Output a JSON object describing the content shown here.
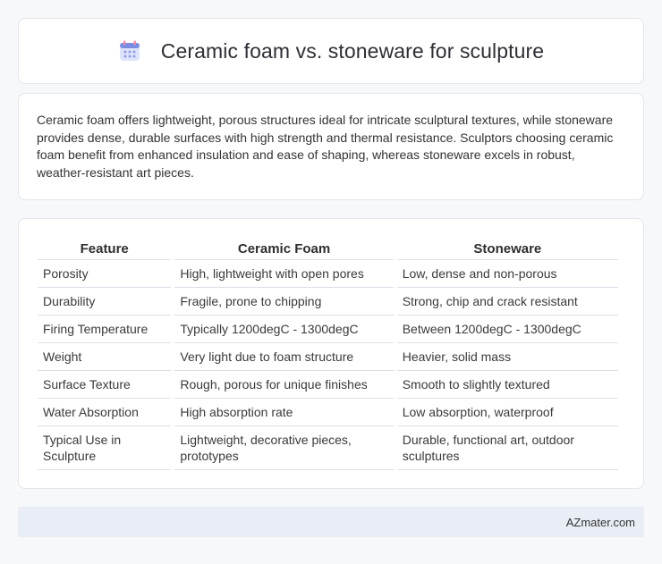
{
  "header": {
    "title": "Ceramic foam vs. stoneware for sculpture",
    "icon": "calendar-icon"
  },
  "intro": {
    "text": "Ceramic foam offers lightweight, porous structures ideal for intricate sculptural textures, while stoneware provides dense, durable surfaces with high strength and thermal resistance. Sculptors choosing ceramic foam benefit from enhanced insulation and ease of shaping, whereas stoneware excels in robust, weather-resistant art pieces."
  },
  "table": {
    "headers": [
      "Feature",
      "Ceramic Foam",
      "Stoneware"
    ],
    "rows": [
      [
        "Porosity",
        "High, lightweight with open pores",
        "Low, dense and non-porous"
      ],
      [
        "Durability",
        "Fragile, prone to chipping",
        "Strong, chip and crack resistant"
      ],
      [
        "Firing Temperature",
        "Typically 1200degC - 1300degC",
        "Between 1200degC - 1300degC"
      ],
      [
        "Weight",
        "Very light due to foam structure",
        "Heavier, solid mass"
      ],
      [
        "Surface Texture",
        "Rough, porous for unique finishes",
        "Smooth to slightly textured"
      ],
      [
        "Water Absorption",
        "High absorption rate",
        "Low absorption, waterproof"
      ],
      [
        "Typical Use in Sculpture",
        "Lightweight, decorative pieces, prototypes",
        "Durable, functional art, outdoor sculptures"
      ]
    ]
  },
  "footer": {
    "brand": "AZmater.com"
  },
  "colors": {
    "icon_primary": "#7b8de0",
    "icon_accent": "#f08aa8",
    "footer_bg": "#e9eef6"
  }
}
